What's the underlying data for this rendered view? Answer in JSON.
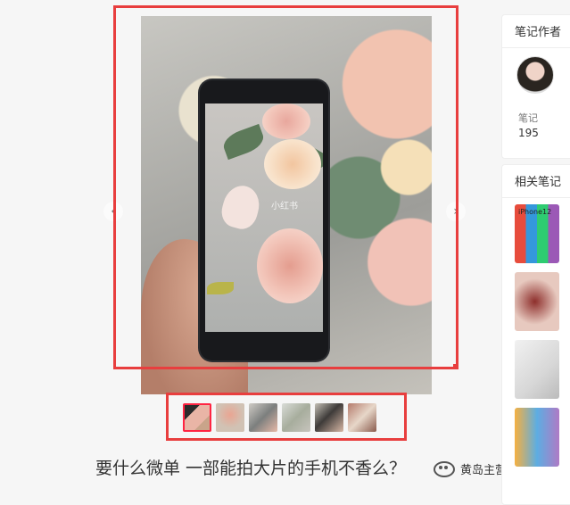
{
  "note": {
    "title": "要什么微单 一部能拍大片的手机不香么？",
    "photo_watermark": "小红书",
    "thumbnail_count": 6,
    "active_thumbnail": 0
  },
  "sidebar": {
    "author_card_title": "笔记作者",
    "stat_label": "笔记",
    "stat_value": "195",
    "related_card_title": "相关笔记",
    "related_caption": "iPhone12"
  },
  "watermark": {
    "text": "黄岛主营销笔记"
  },
  "colors": {
    "highlight": "#e83e3e",
    "active_thumb": "#ff2442"
  },
  "icons": {
    "prev": "chevron-left-icon",
    "next": "chevron-right-icon",
    "wechat": "wechat-icon"
  }
}
